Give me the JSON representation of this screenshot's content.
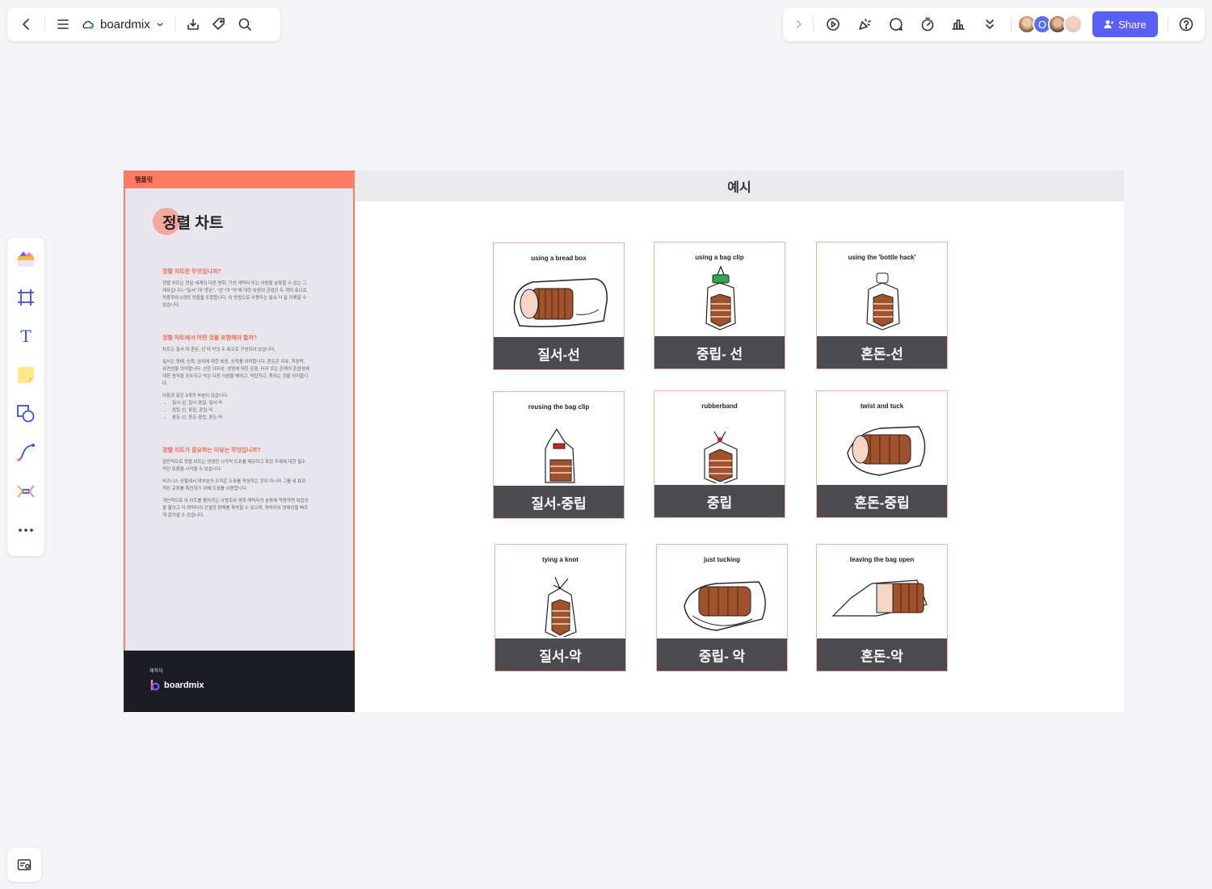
{
  "app": {
    "file_name": "boardmix"
  },
  "toolbar_right": {
    "share_label": "Share",
    "avatar_initial": "O"
  },
  "board": {
    "left_panel": {
      "tag": "템플릿",
      "title": "정렬 차트",
      "sections": [
        {
          "heading": "정렬 차트란 무엇입니까?",
          "paragraphs": [
            "정렬 차트는 현실 세계의 다른 영화, 가상 캐릭터 또는 사람을 분류할 수 있는 그래프입니다. \"질서\" 대 \"혼돈\", \"선\" 대 \"악\"에 대한 차원의 관점은 두 개의 축으로 작용하여 9개의 정렬을 조합합니다. 이 방법으로 사용자는 필요 더 잘 이해할 수 있습니다."
          ]
        },
        {
          "heading": "정렬 차트에서 어떤 것을 포함해야 할까?",
          "paragraphs": [
            "차트는 질서 대 혼돈, 선 대 악의 두 축으로 구성되어 있습니다.",
            "질서는 명예, 신뢰, 권위에 대한 복종, 신뢰를 의미합니다. 혼돈은 자유, 적응력, 유연성을 의미합니다. 선한 의미상, 생명에 대한 존중, 타자 또는 존재의 존엄성에 대한 생각을 모두하고 악은 다른 사람을 해치고, 억압하고, 죽이는 것을 의미합니다.",
            "다음과 같은 9개의 부분이 있습니다."
          ],
          "bullets": [
            "질서-선, 질서-중립, 질서-악",
            "중립-선, 중립, 중립-악",
            "혼돈-선, 혼돈-중립, 혼돈-악"
          ]
        },
        {
          "heading": "정렬 차트가 중요하는 이유는 무엇입니까?",
          "paragraphs": [
            "일반적으로 정렬 차트는 생생한 시각적 도표를 제공하고 특정 주제에 대한 필수적인 토론을 시작할 수 있습니다.",
            "비즈니스 상황에서 대부분의 조직은 도표를 작성하는 것이 아니라 그룹 내 효과적인 교류를 촉진하기 위해 도표를 사용합니다.",
            "개인적으로 이 차트를 좋아하는 사람조차 영화 캐릭터의 분류에 적용하면 복잡성을 줄이고 각 캐릭터의 간결한 판매를 파악할 수 있으며, 캐릭터의 정체성을 빠르게 알아낼 수 있습니다."
          ]
        }
      ],
      "footer_label": "제작자",
      "footer_logo": "boardmix"
    },
    "right_panel": {
      "header": "예시",
      "cards": [
        {
          "caption": "using a bread box",
          "label": "질서-선"
        },
        {
          "caption": "using a bag clip",
          "label": "중립- 선"
        },
        {
          "caption": "using the 'bottle hack'",
          "label": "혼돈-선"
        },
        {
          "caption": "reusing the bag clip",
          "label": "질서-중립"
        },
        {
          "caption": "rubberband",
          "label": "중립"
        },
        {
          "caption": "twist and tuck",
          "label": "혼돈-중립"
        },
        {
          "caption": "tying a knot",
          "label": "질서-악"
        },
        {
          "caption": "just tucking",
          "label": "중립- 악"
        },
        {
          "caption": "leaving the bag open",
          "label": "혼돈-악"
        }
      ]
    }
  },
  "colors": {
    "accent": "#ff7a63",
    "share_button": "#5a5ff5",
    "card_label_bg": "#4b4b4f",
    "card_border": "#f3b1a5",
    "bread_crust": "#a0522d",
    "bread_inner": "#f5d5c5"
  },
  "icons": {
    "toolbar_left": [
      "back-icon",
      "menu-icon",
      "cloud-icon",
      "chevron-down-icon",
      "download-icon",
      "tag-icon",
      "search-icon"
    ],
    "toolbar_right": [
      "chevron-right-icon",
      "play-icon",
      "celebrate-icon",
      "comment-icon",
      "timer-icon",
      "vote-icon",
      "more-chevrons-icon",
      "help-icon"
    ],
    "left_tools": [
      "templates-icon",
      "frame-icon",
      "text-icon",
      "sticky-note-icon",
      "shape-icon",
      "connector-icon",
      "mindmap-icon",
      "more-icon"
    ]
  }
}
